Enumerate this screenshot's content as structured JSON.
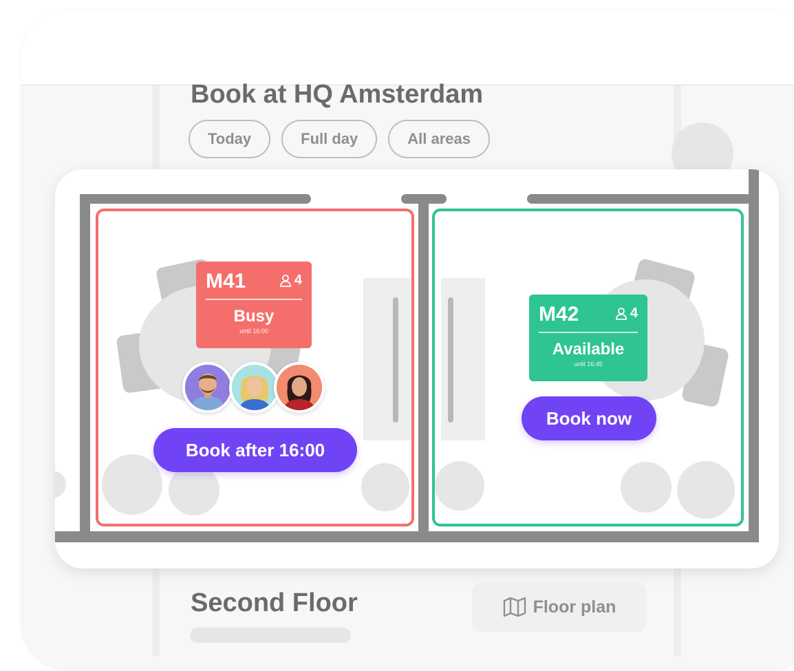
{
  "page": {
    "title": "Book at HQ Amsterdam",
    "filters": [
      {
        "label": "Today"
      },
      {
        "label": "Full day"
      },
      {
        "label": "All areas"
      }
    ]
  },
  "rooms": [
    {
      "name": "M41",
      "capacity": "4",
      "status": "Busy",
      "until": "until 16:00",
      "action": "Book after 16:00",
      "status_color": "#f46f6c",
      "attendees": [
        "person-avatar-man",
        "person-avatar-blonde-woman",
        "person-avatar-dark-haired-woman"
      ]
    },
    {
      "name": "M42",
      "capacity": "4",
      "status": "Available",
      "until": "until 16:45",
      "action": "Book now",
      "status_color": "#2fc493"
    }
  ],
  "section": {
    "title": "Second Floor",
    "floor_plan_label": "Floor plan"
  },
  "colors": {
    "accent": "#7044f5",
    "busy": "#f46f6c",
    "available": "#2fc493",
    "wall": "#8a8a8a"
  },
  "icons": {
    "capacity": "person-icon",
    "floor_plan": "map-icon"
  }
}
